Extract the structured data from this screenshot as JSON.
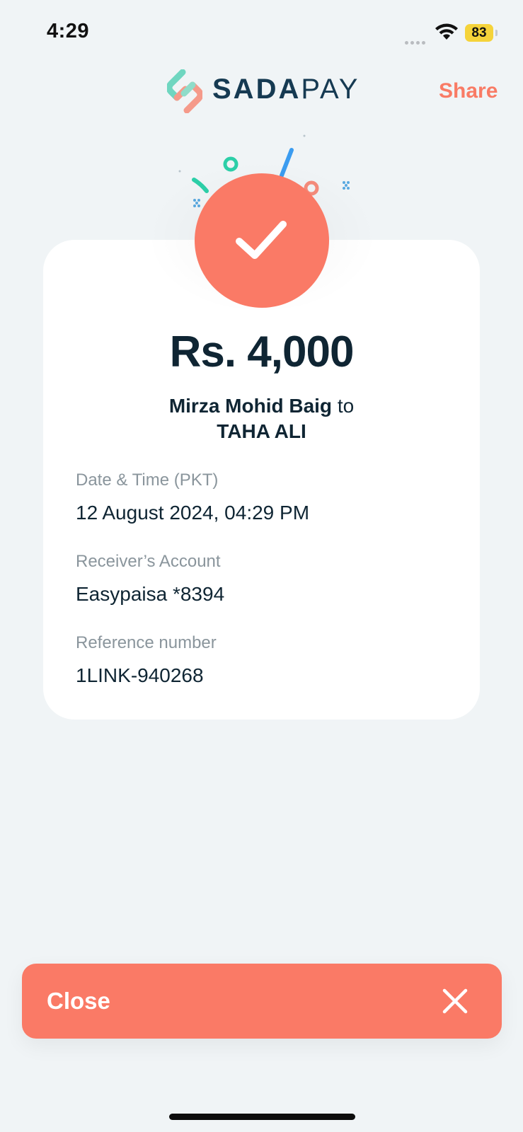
{
  "status_bar": {
    "time": "4:29",
    "battery": "83",
    "icons": [
      "cellular-signal-icon",
      "wifi-icon",
      "battery-icon"
    ]
  },
  "header": {
    "brand_part1": "SADA",
    "brand_part2": "PAY",
    "share_label": "Share"
  },
  "receipt": {
    "amount": "Rs. 4,000",
    "sender": "Mirza Mohid Baig",
    "connector": "to",
    "receiver": "TAHA ALI",
    "fields": [
      {
        "label": "Date & Time (PKT)",
        "value": "12 August 2024, 04:29 PM"
      },
      {
        "label": "Receiver’s Account",
        "value": "Easypaisa *8394"
      },
      {
        "label": "Reference number",
        "value": "1LINK-940268"
      }
    ]
  },
  "footer": {
    "close_label": "Close"
  },
  "colors": {
    "accent": "#fa7a66",
    "text_dark": "#0f2533",
    "label_gray": "#8a959c",
    "background": "#f0f4f6"
  }
}
